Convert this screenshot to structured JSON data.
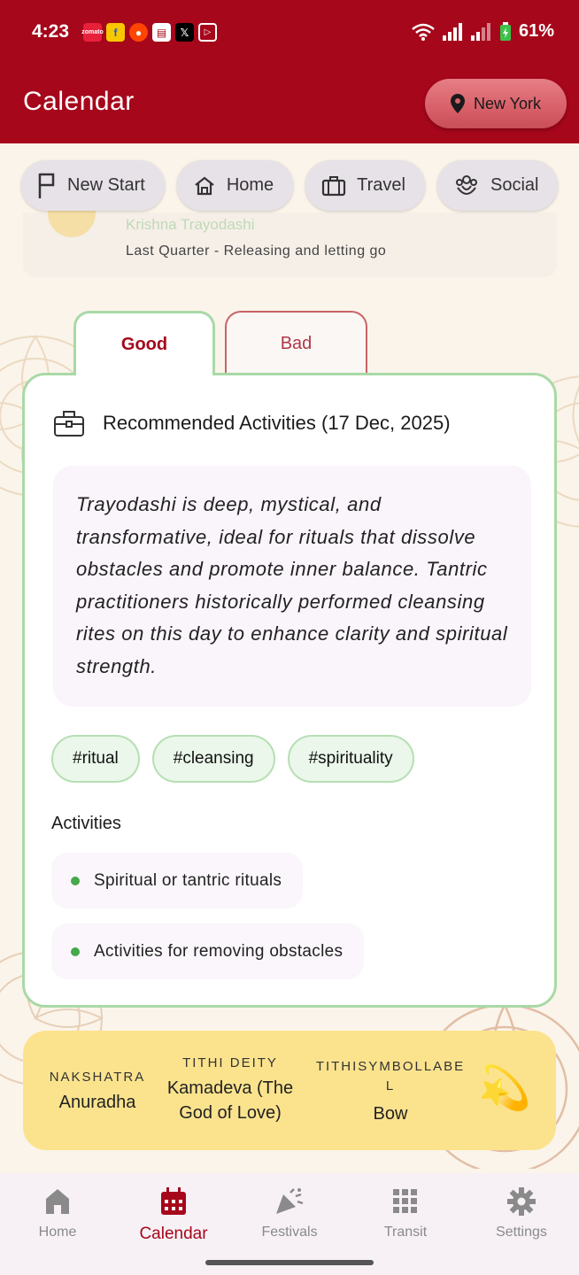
{
  "status_bar": {
    "time": "4:23",
    "battery": "61%"
  },
  "app_bar": {
    "title": "Calendar",
    "location": "New York"
  },
  "chips": [
    {
      "label": "New Start",
      "icon": "flag-icon"
    },
    {
      "label": "Home",
      "icon": "house-icon"
    },
    {
      "label": "Travel",
      "icon": "suitcase-icon"
    },
    {
      "label": "Social",
      "icon": "people-icon"
    }
  ],
  "prev_card": {
    "partial_title": "Krishna Trayodashi",
    "phase": "Last Quarter - Releasing and letting go"
  },
  "tabs": {
    "good": "Good",
    "bad": "Bad"
  },
  "recommended": {
    "title": "Recommended Activities (17 Dec, 2025)",
    "description": "Trayodashi is deep, mystical, and transformative, ideal for rituals that dissolve obstacles and promote inner balance. Tantric practitioners historically performed cleansing rites on this day to enhance clarity and spiritual strength.",
    "tags": [
      "#ritual",
      "#cleansing",
      "#spirituality"
    ],
    "activities_label": "Activities",
    "activities": [
      "Spiritual or tantric rituals",
      "Activities for removing obstacles"
    ]
  },
  "info": {
    "nakshatra_label": "NAKSHATRA",
    "nakshatra_value": "Anuradha",
    "deity_label": "TITHI DEITY",
    "deity_value": "Kamadeva (The God of Love)",
    "symbol_label": "TITHISYMBOLLABEL",
    "symbol_value": "Bow",
    "emoji": "💫"
  },
  "nav": [
    {
      "label": "Home",
      "icon": "home-icon"
    },
    {
      "label": "Calendar",
      "icon": "calendar-icon"
    },
    {
      "label": "Festivals",
      "icon": "party-icon"
    },
    {
      "label": "Transit",
      "icon": "grid-icon"
    },
    {
      "label": "Settings",
      "icon": "gear-icon"
    }
  ],
  "colors": {
    "primary": "#a6071b",
    "good_border": "#a9d9a6",
    "bad_border": "#c76465",
    "info_bg": "#fbe38e",
    "tag_bg": "#eaf7ea",
    "active_dot": "#45a84a"
  }
}
